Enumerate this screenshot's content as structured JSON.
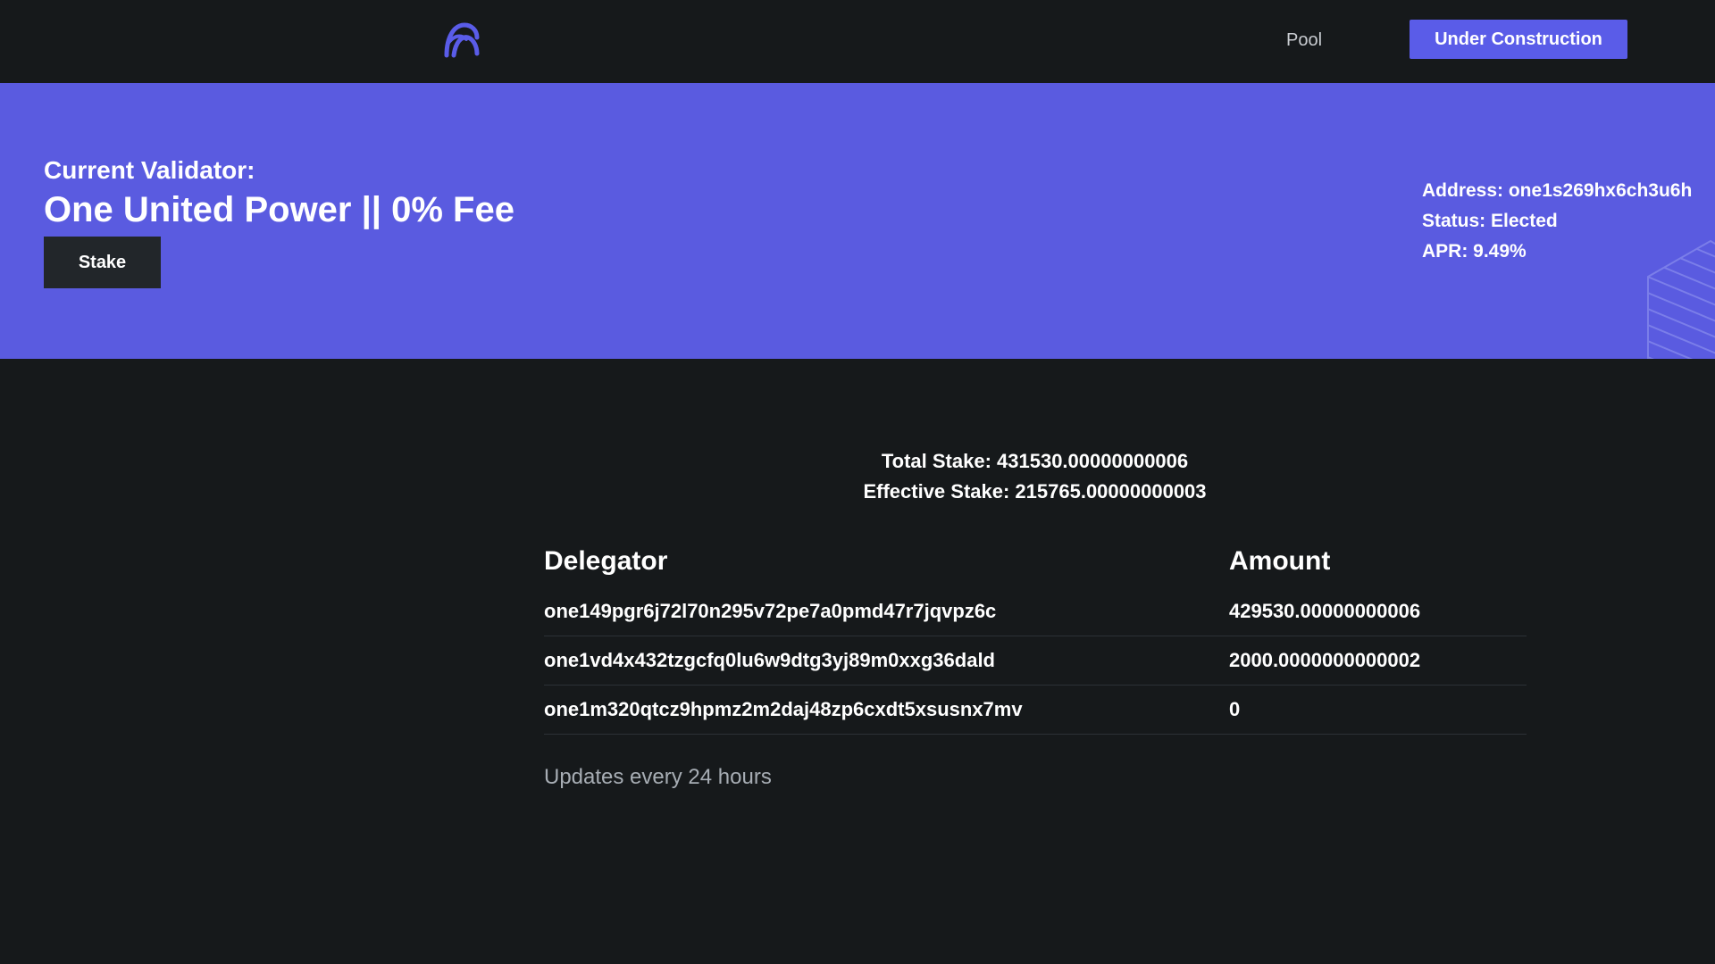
{
  "nav": {
    "logo_icon": "harmony-logo-icon",
    "pool_label": "Pool",
    "cta_label": "Under Construction"
  },
  "colors": {
    "background": "#16191b",
    "accent": "#5a5ce8",
    "hero": "#5a5be0",
    "button_dark": "#22262a",
    "muted_text": "#a7adb4"
  },
  "hero": {
    "eyebrow": "Current Validator:",
    "validator_name": "One United Power || 0% Fee",
    "stake_button": "Stake",
    "address": "Address: one1s269hx6ch3u6h",
    "status": "Status: Elected",
    "apr": "APR: 9.49%"
  },
  "stats": {
    "total_stake": "Total Stake: 431530.00000000006",
    "effective_stake": "Effective Stake: 215765.00000000003"
  },
  "table": {
    "headers": [
      "Delegator",
      "Amount"
    ],
    "rows": [
      {
        "delegator": "one149pgr6j72l70n295v72pe7a0pmd47r7jqvpz6c",
        "amount": "429530.00000000006"
      },
      {
        "delegator": "one1vd4x432tzgcfq0lu6w9dtg3yj89m0xxg36dald",
        "amount": "2000.0000000000002"
      },
      {
        "delegator": "one1m320qtcz9hpmz2m2daj48zp6cxdt5xsusnx7mv",
        "amount": "0"
      }
    ]
  },
  "footnote": "Updates every 24 hours"
}
